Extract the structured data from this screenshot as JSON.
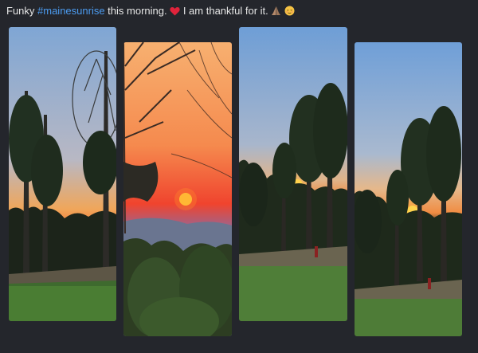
{
  "post": {
    "text_before": "Funky ",
    "hashtag": "#mainesunrise",
    "text_after": " this morning. ",
    "text_end": " I am thankful for it. ",
    "emojis": [
      "red-heart",
      "folded-hands",
      "relieved-face"
    ]
  },
  "photos": [
    {
      "subject": "sunrise-through-trees"
    },
    {
      "subject": "orange-sky-sunrise"
    },
    {
      "subject": "sunrise-behind-pines"
    },
    {
      "subject": "sunrise-over-lawn"
    }
  ],
  "colors": {
    "background": "#24262c",
    "text": "#e6e6e6",
    "hashtag": "#4c9cf1"
  }
}
